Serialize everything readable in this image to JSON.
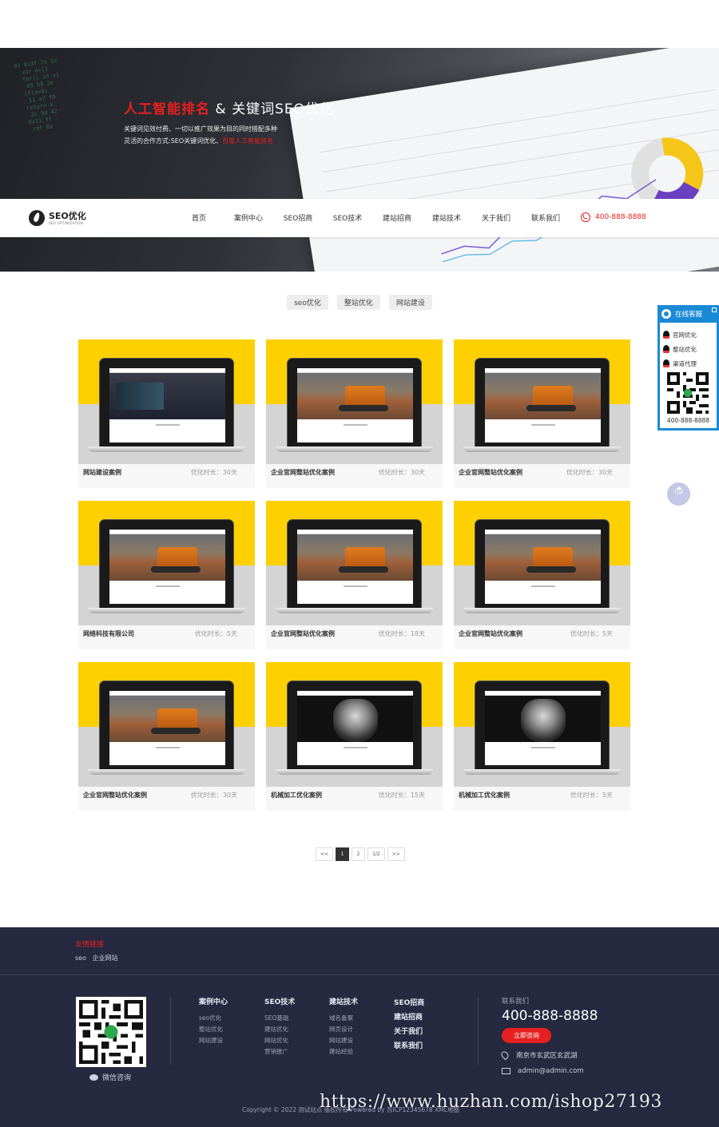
{
  "banner": {
    "headline_red": "人工智能排名",
    "headline_amp": " & ",
    "headline_rest": "关键词SEO优化",
    "sub_line1": "关键词见效付费、一切以推广效果为目的同时搭配多种",
    "sub_line2_a": "灵活的合作方式:SEO关键词优化、",
    "sub_line2_b": "百度人工智能排名"
  },
  "nav": {
    "logo_title": "SEO优化",
    "logo_sub": "SEO OPTIMIZATION",
    "items": [
      "首页",
      "案例中心",
      "SEO招商",
      "SEO技术",
      "建站招商",
      "建站技术",
      "关于我们",
      "联系我们"
    ],
    "phone": "400-888-8888",
    "phone_icon": "phone-icon"
  },
  "filters": [
    "seo优化",
    "整站优化",
    "网站建设"
  ],
  "cards": [
    {
      "name": "网站建设案例",
      "duration": "优化时长：30天",
      "screen": "dark"
    },
    {
      "name": "企业官网整站优化案例",
      "duration": "优化时长：30天",
      "screen": "excavator"
    },
    {
      "name": "企业官网整站优化案例",
      "duration": "优化时长：30天",
      "screen": "excavator"
    },
    {
      "name": "网络科技有限公司",
      "duration": "优化时长：5天",
      "screen": "excavator"
    },
    {
      "name": "企业官网整站优化案例",
      "duration": "优化时长：18天",
      "screen": "excavator"
    },
    {
      "name": "企业官网整站优化案例",
      "duration": "优化时长：5天",
      "screen": "excavator"
    },
    {
      "name": "企业官网整站优化案例",
      "duration": "优化时长：30天",
      "screen": "excavator"
    },
    {
      "name": "机械加工优化案例",
      "duration": "优化时长：15天",
      "screen": "black"
    },
    {
      "name": "机械加工优化案例",
      "duration": "优化时长：5天",
      "screen": "black"
    }
  ],
  "pager": [
    "<<",
    "1",
    "2",
    "1/2",
    ">>"
  ],
  "side_widget": {
    "title": "在线客服",
    "items": [
      "官网优化",
      "整站优化",
      "渠道代理"
    ],
    "tel": "400-888-8888"
  },
  "top_button": "TOP",
  "footer": {
    "links_title": "友情链接",
    "links": [
      "seo",
      "企业网站"
    ],
    "wechat_label": "微信咨询",
    "columns": [
      {
        "title": "案例中心",
        "items": [
          "seo优化",
          "整站优化",
          "网站建设"
        ]
      },
      {
        "title": "SEO技术",
        "items": [
          "SEO基础",
          "建站优化",
          "网站优化",
          "营销推广"
        ]
      },
      {
        "title": "建站技术",
        "items": [
          "域名备案",
          "网页设计",
          "网站建设",
          "建站经验"
        ]
      }
    ],
    "bold_links": [
      "SEO招商",
      "建站招商",
      "关于我们",
      "联系我们"
    ],
    "contact_label": "联系我们",
    "phone": "400-888-8888",
    "consult_button": "立即咨询",
    "address": "南京市玄武区玄武湖",
    "email": "admin@admin.com",
    "copyright": "Copyright © 2022 测试站点 版权所有 Powered by   苏ICP12345678   XML地图"
  },
  "watermark": "https://www.huzhan.com/ishop27193"
}
